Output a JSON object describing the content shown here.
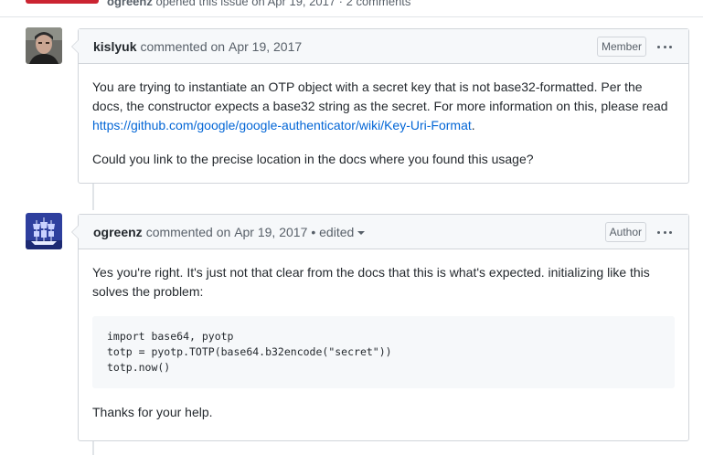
{
  "issue_meta": {
    "author": "ogreenz",
    "rest": "opened this issue on Apr 19, 2017 · 2 comments"
  },
  "comments": [
    {
      "author": "kislyuk",
      "action": "commented on",
      "date": "Apr 19, 2017",
      "role_badge": "Member",
      "avatar_icon": "user-photo-avatar",
      "body": {
        "p1_text": "You are trying to instantiate an OTP object with a secret key that is not base32-formatted. Per the docs, the constructor expects a base32 string as the secret. For more information on this, please read ",
        "p1_link": "https://github.com/google/google-authenticator/wiki/Key-Uri-Format",
        "p1_end": ".",
        "p2": "Could you link to the precise location in the docs where you found this usage?"
      }
    },
    {
      "author": "ogreenz",
      "action": "commented on",
      "date": "Apr 19, 2017",
      "edited": "• edited",
      "role_badge": "Author",
      "avatar_icon": "ship-avatar",
      "body": {
        "p1": "Yes you're right. It's just not that clear from the docs that this is what's expected. initializing like this solves the problem:",
        "code": "import base64, pyotp\ntotp = pyotp.TOTP(base64.b32encode(\"secret\"))\ntotp.now()",
        "p2": "Thanks for your help."
      }
    }
  ],
  "colors": {
    "link": "#0366d6",
    "closed_badge": "#cb2431",
    "header_bg": "#f6f8fa",
    "border": "#d1d5da"
  }
}
